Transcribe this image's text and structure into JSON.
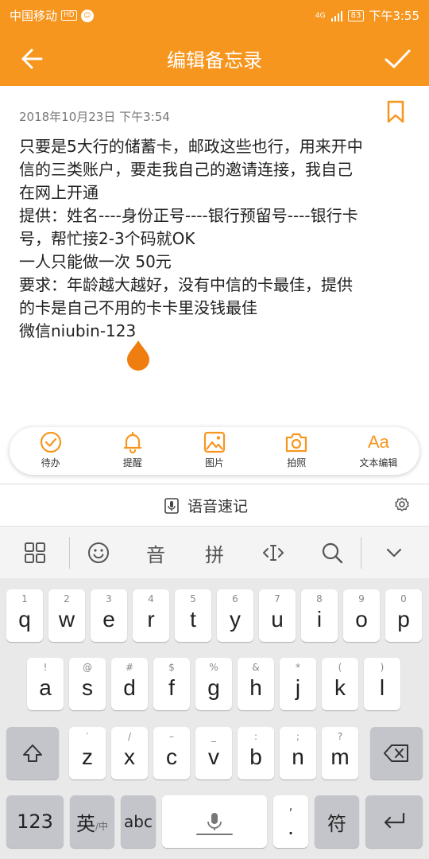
{
  "status": {
    "carrier": "中国移动",
    "hd": "HD",
    "signal": "4G",
    "battery": "83",
    "time": "下午3:55"
  },
  "header": {
    "title": "编辑备忘录",
    "back_icon": "arrow-left-icon",
    "confirm_icon": "checkmark-icon"
  },
  "note": {
    "date": "2018年10月23日 下午3:54",
    "lines": [
      "只要是5大行的储蓄卡，邮政这些也行，用来开中",
      "信的三类账户，要走我自己的邀请连接，我自己",
      "在网上开通",
      "提供：姓名----身份正号----银行预留号----银行卡",
      "号，帮忙接2-3个码就OK",
      "一人只能做一次  50元",
      "要求：年龄越大越好，没有中信的卡最佳，提供",
      "的卡是自己不用的卡卡里没钱最佳",
      "微信niubin-123"
    ]
  },
  "toolbar": {
    "todo": "待办",
    "remind": "提醒",
    "image": "图片",
    "photo": "拍照",
    "text_icon": "Aa",
    "text_edit": "文本编辑"
  },
  "voice": {
    "label": "语音速记"
  },
  "ime": {
    "voice_key": "音",
    "pinyin_key": "拼"
  },
  "keyboard": {
    "row1": [
      [
        "1",
        "q"
      ],
      [
        "2",
        "w"
      ],
      [
        "3",
        "e"
      ],
      [
        "4",
        "r"
      ],
      [
        "5",
        "t"
      ],
      [
        "6",
        "y"
      ],
      [
        "7",
        "u"
      ],
      [
        "8",
        "i"
      ],
      [
        "9",
        "o"
      ],
      [
        "0",
        "p"
      ]
    ],
    "row2": [
      [
        "!",
        "a"
      ],
      [
        "@",
        "s"
      ],
      [
        "#",
        "d"
      ],
      [
        "$",
        "f"
      ],
      [
        "%",
        "g"
      ],
      [
        "&",
        "h"
      ],
      [
        "*",
        "j"
      ],
      [
        "(",
        "k"
      ],
      [
        ")",
        "l"
      ]
    ],
    "row3": [
      [
        "′",
        "z"
      ],
      [
        "/",
        "x"
      ],
      [
        "–",
        "c"
      ],
      [
        "_",
        "v"
      ],
      [
        ":",
        "b"
      ],
      [
        ";",
        "n"
      ],
      [
        "?",
        "m"
      ]
    ],
    "num_key": "123",
    "lang_key_main": "英",
    "lang_key_sub": "/中",
    "abc_key": "abc",
    "comma_top": ",",
    "period": ".",
    "symbol_key": "符"
  },
  "colors": {
    "accent": "#f7961e"
  }
}
